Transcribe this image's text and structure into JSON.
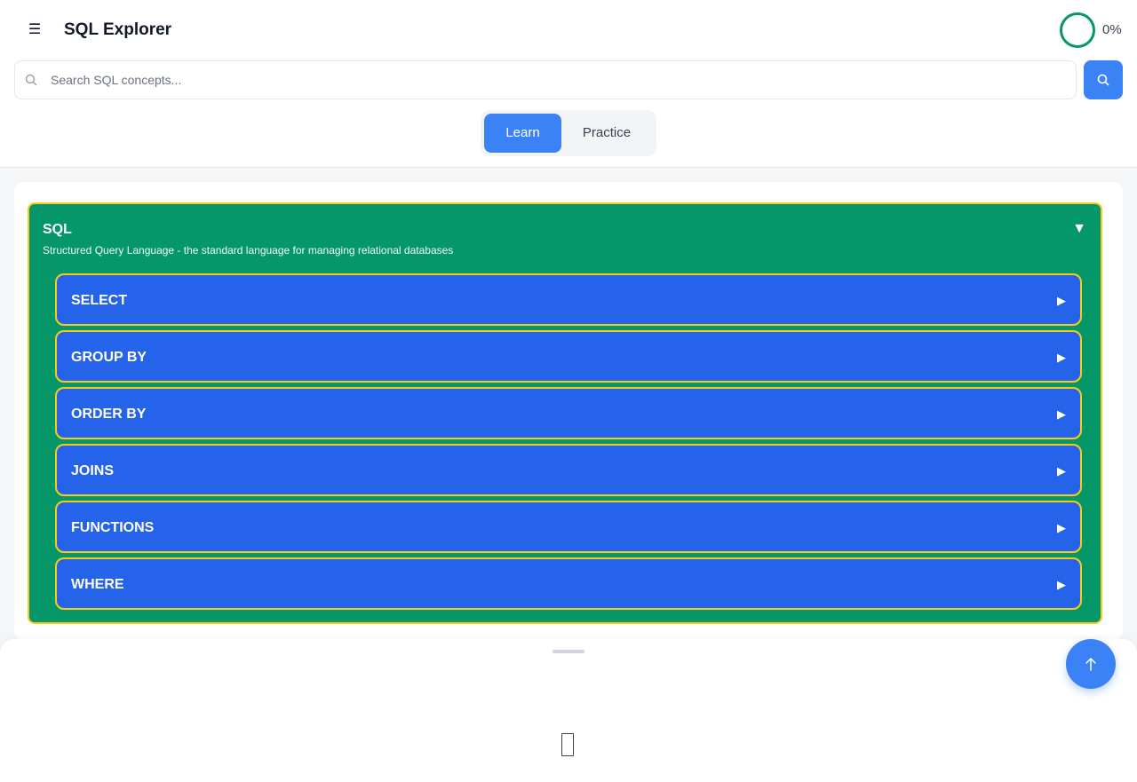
{
  "header": {
    "menu_icon": "☰",
    "title": "SQL Explorer",
    "progress_percent": 0,
    "progress_label": "0%"
  },
  "search": {
    "placeholder": "Search SQL concepts...",
    "value": ""
  },
  "modes": {
    "learn_label": "Learn",
    "practice_label": "Practice",
    "active": "Learn"
  },
  "tree": {
    "root": {
      "title": "SQL",
      "description": "Structured Query Language - the standard language for managing relational databases",
      "toggle_icon": "▼",
      "expanded": true
    },
    "children": [
      {
        "label": "SELECT",
        "arrow": "▶"
      },
      {
        "label": "GROUP BY",
        "arrow": "▶"
      },
      {
        "label": "ORDER BY",
        "arrow": "▶"
      },
      {
        "label": "JOINS",
        "arrow": "▶"
      },
      {
        "label": "FUNCTIONS",
        "arrow": "▶"
      },
      {
        "label": "WHERE",
        "arrow": "▶"
      }
    ]
  },
  "colors": {
    "accent": "#3b82f6",
    "root_node": "#059669",
    "child_node": "#2563eb",
    "node_border": "#facc15",
    "progress_ring": "#059669"
  }
}
